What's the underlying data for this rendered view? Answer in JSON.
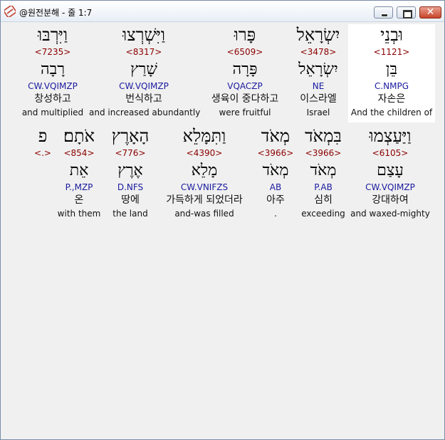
{
  "window": {
    "title": "@원전분해 - 줄 1:7",
    "close_label": "✕"
  },
  "rows": [
    {
      "words": [
        {
          "hebrew": "וּבְנֵי",
          "strong": "<1121>",
          "lemma": "בֵּן",
          "parse": "C.NMPG",
          "korean": "자손은",
          "english": "And the children of"
        },
        {
          "hebrew": "יִשְׂרָאֵל",
          "strong": "<3478>",
          "lemma": "יִשְׂרָאֵל",
          "parse": "NE",
          "korean": "이스라엘",
          "english": "Israel"
        },
        {
          "hebrew": "פָּרוּ",
          "strong": "<6509>",
          "lemma": "פָּרָה",
          "parse": "VQACZP",
          "korean": "생육이 중다하고",
          "english": "were fruitful"
        },
        {
          "hebrew": "וַיִּשְׁרְצוּ",
          "strong": "<8317>",
          "lemma": "שָׁרַץ",
          "parse": "CW.VQIMZP",
          "korean": "번식하고",
          "english": "and increased abundantly"
        },
        {
          "hebrew": "וַיִּרְבּוּ",
          "strong": "<7235>",
          "lemma": "רָבָה",
          "parse": "CW.VQIMZP",
          "korean": "창성하고",
          "english": "and multiplied"
        }
      ]
    },
    {
      "words": [
        {
          "hebrew": "וַיַּעַצְמוּ",
          "strong": "<6105>",
          "lemma": "עָצַם",
          "parse": "CW.VQIMZP",
          "korean": "강대하여",
          "english": "and waxed-mighty"
        },
        {
          "hebrew": "בִּמְאֹד",
          "strong": "<3966>",
          "lemma": "מְאֹד",
          "parse": "P.AB",
          "korean": "심히",
          "english": "exceeding"
        },
        {
          "hebrew": "מְאֹד",
          "strong": "<3966>",
          "lemma": "מְאֹד",
          "parse": "AB",
          "korean": "아주",
          "english": "."
        },
        {
          "hebrew": "וַתִּמָּלֵא",
          "strong": "<4390>",
          "lemma": "מָלֵא",
          "parse": "CW.VNIFZS",
          "korean": "가득하게 되었더라",
          "english": "and-was filled"
        },
        {
          "hebrew": "הָאָרֶץ",
          "strong": "<776>",
          "lemma": "אֶרֶץ",
          "parse": "D.NFS",
          "korean": "땅에",
          "english": "the land"
        },
        {
          "hebrew": "אֹתָם׃",
          "strong": "<854>",
          "lemma": "אֵת",
          "parse": "P.,MZP",
          "korean": "온",
          "english": "with them"
        },
        {
          "hebrew": "פ",
          "strong": "<.>",
          "lemma": "",
          "parse": "",
          "korean": "",
          "english": ""
        }
      ]
    }
  ]
}
